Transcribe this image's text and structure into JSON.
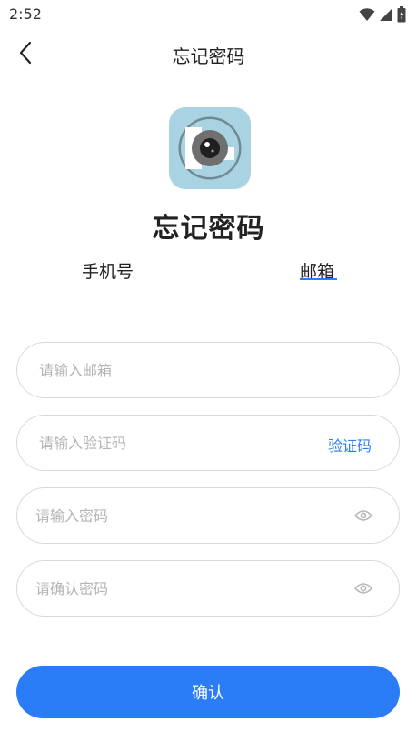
{
  "status_bar": {
    "time": "2:52"
  },
  "app_bar": {
    "title": "忘记密码"
  },
  "page": {
    "heading": "忘记密码"
  },
  "tabs": [
    {
      "label": "手机号",
      "active": false
    },
    {
      "label": "邮箱",
      "active": true
    }
  ],
  "form": {
    "email_placeholder": "请输入邮箱",
    "code_placeholder": "请输入验证码",
    "code_button": "验证码",
    "password_placeholder": "请输入密码",
    "confirm_password_placeholder": "请确认密码",
    "submit_label": "确认"
  },
  "colors": {
    "accent": "#2a7df6",
    "logo_bg": "#a9d3e3"
  },
  "icons": [
    "back-arrow-icon",
    "wifi-icon",
    "signal-icon",
    "battery-icon",
    "eye-icon",
    "app-logo-icon"
  ]
}
